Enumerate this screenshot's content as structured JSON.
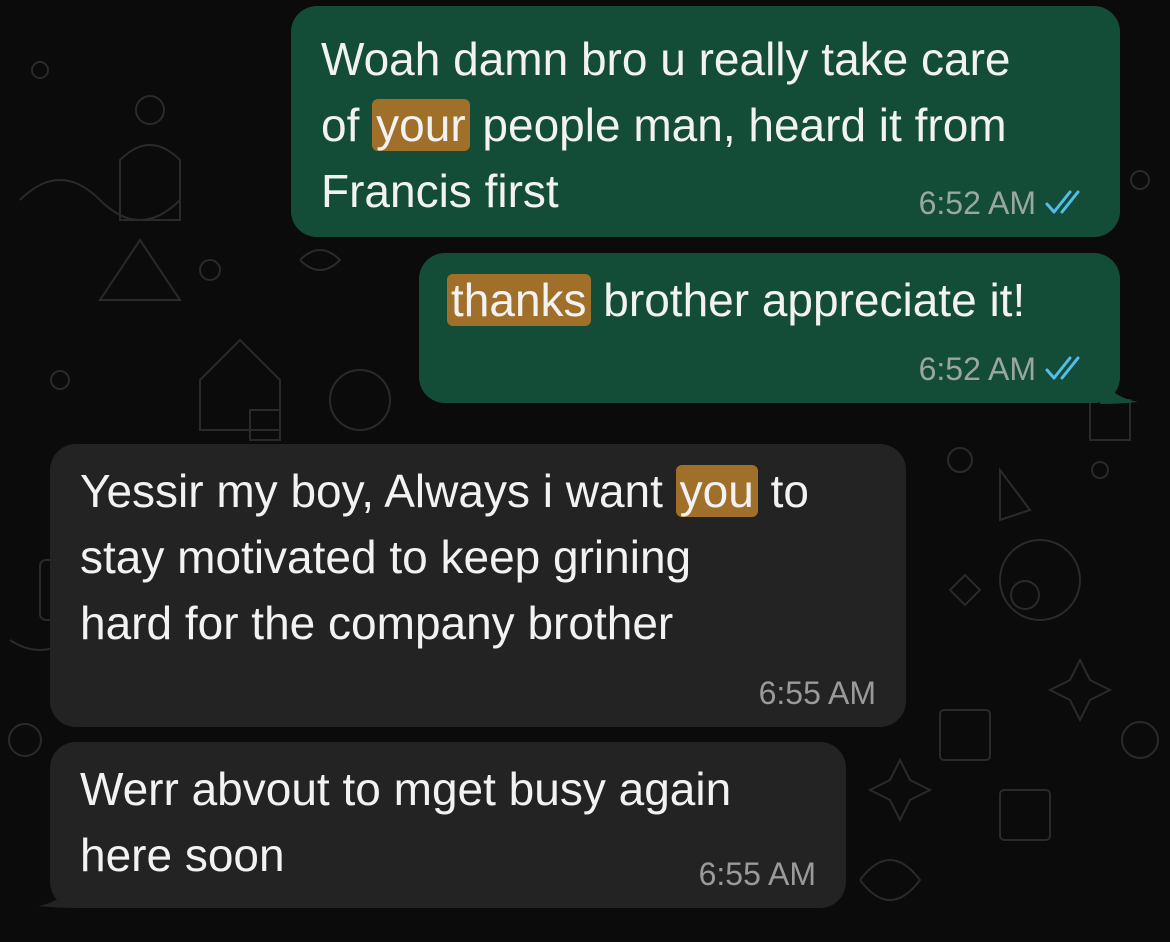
{
  "conversation": {
    "messages": [
      {
        "direction": "outgoing",
        "text_parts": [
          "Woah damn bro u really take care\nof ",
          "your",
          " people man, heard it from\nFrancis first"
        ],
        "time": "6:52 AM",
        "status_icon": "double-check-read-icon"
      },
      {
        "direction": "outgoing",
        "text_parts": [
          "",
          "thanks",
          " brother appreciate it!"
        ],
        "time": "6:52 AM",
        "status_icon": "double-check-read-icon"
      },
      {
        "direction": "incoming",
        "text_parts": [
          "Yessir my boy, Always i want ",
          "you",
          " to\nstay motivated to keep grining\nhard for the company brother"
        ],
        "time": "6:55 AM"
      },
      {
        "direction": "incoming",
        "text_parts": [
          "Werr abvout to mget busy again\nhere soon"
        ],
        "time": "6:55 AM"
      }
    ]
  },
  "colors": {
    "background": "#0b0b0b",
    "outgoing_bubble": "#144d37",
    "incoming_bubble": "#222322",
    "highlight": "#a0702a",
    "read_ticks": "#53bdeb"
  }
}
